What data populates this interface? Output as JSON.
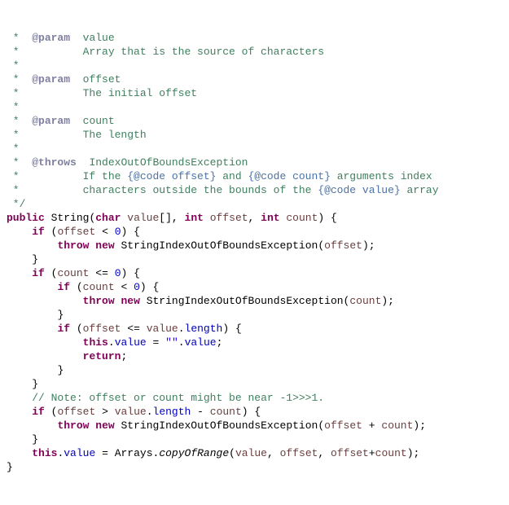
{
  "doc": {
    "star": " *",
    "starEnd": " */",
    "param1_tag": "@param",
    "param1_name": "value",
    "param1_desc": "Array that is the source of characters",
    "param2_tag": "@param",
    "param2_name": "offset",
    "param2_desc": "The initial offset",
    "param3_tag": "@param",
    "param3_name": "count",
    "param3_desc": "The length",
    "throws_tag": "@throws",
    "throws_type": "IndexOutOfBoundsException",
    "throws_desc1a": "If the ",
    "throws_code1": "{@code offset}",
    "throws_desc1b": " and ",
    "throws_code2": "{@code count}",
    "throws_desc1c": " arguments index",
    "throws_desc2a": "characters outside the bounds of the ",
    "throws_code3": "{@code value}",
    "throws_desc2b": " array"
  },
  "code": {
    "kw_public": "public",
    "name_String": "String",
    "kw_char": "char",
    "p_value": "value",
    "brackets": "[]",
    "kw_int": "int",
    "p_offset": "offset",
    "p_count": "count",
    "kw_if": "if",
    "lt": "<",
    "lte": "<=",
    "gt": ">",
    "zero": "0",
    "kw_throw": "throw",
    "kw_new": "new",
    "StringIndexOutOfBoundsException": "StringIndexOutOfBoundsException",
    "f_length": "length",
    "kw_this": "this",
    "f_value": "value",
    "emptystr": "\"\"",
    "kw_return": "return",
    "linecomment": "// Note: offset or count might be near -1>>>1.",
    "plus": "+",
    "minus": "-",
    "eq": "=",
    "Arrays": "Arrays",
    "copyOfRange": "copyOfRange",
    "comma": ","
  },
  "indent": {
    "i0": "    ",
    "docpad": "  ",
    "docpad2": "          "
  }
}
